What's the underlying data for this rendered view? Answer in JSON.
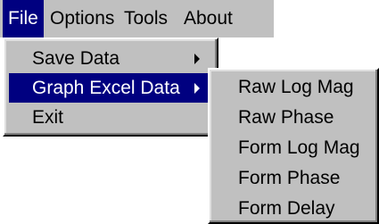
{
  "menubar": {
    "items": [
      {
        "label": "File",
        "selected": true
      },
      {
        "label": "Options"
      },
      {
        "label": "Tools"
      },
      {
        "label": "About"
      }
    ]
  },
  "file_menu": {
    "items": [
      {
        "label": "Save Data",
        "has_submenu": true
      },
      {
        "label": "Graph Excel Data",
        "has_submenu": true,
        "selected": true
      },
      {
        "label": "Exit"
      }
    ]
  },
  "graph_submenu": {
    "items": [
      {
        "label": "Raw Log Mag"
      },
      {
        "label": "Raw Phase"
      },
      {
        "label": "Form Log Mag"
      },
      {
        "label": "Form Phase"
      },
      {
        "label": "Form Delay"
      }
    ]
  },
  "colors": {
    "menu_bg": "#c0c0c0",
    "highlight": "#000080"
  }
}
